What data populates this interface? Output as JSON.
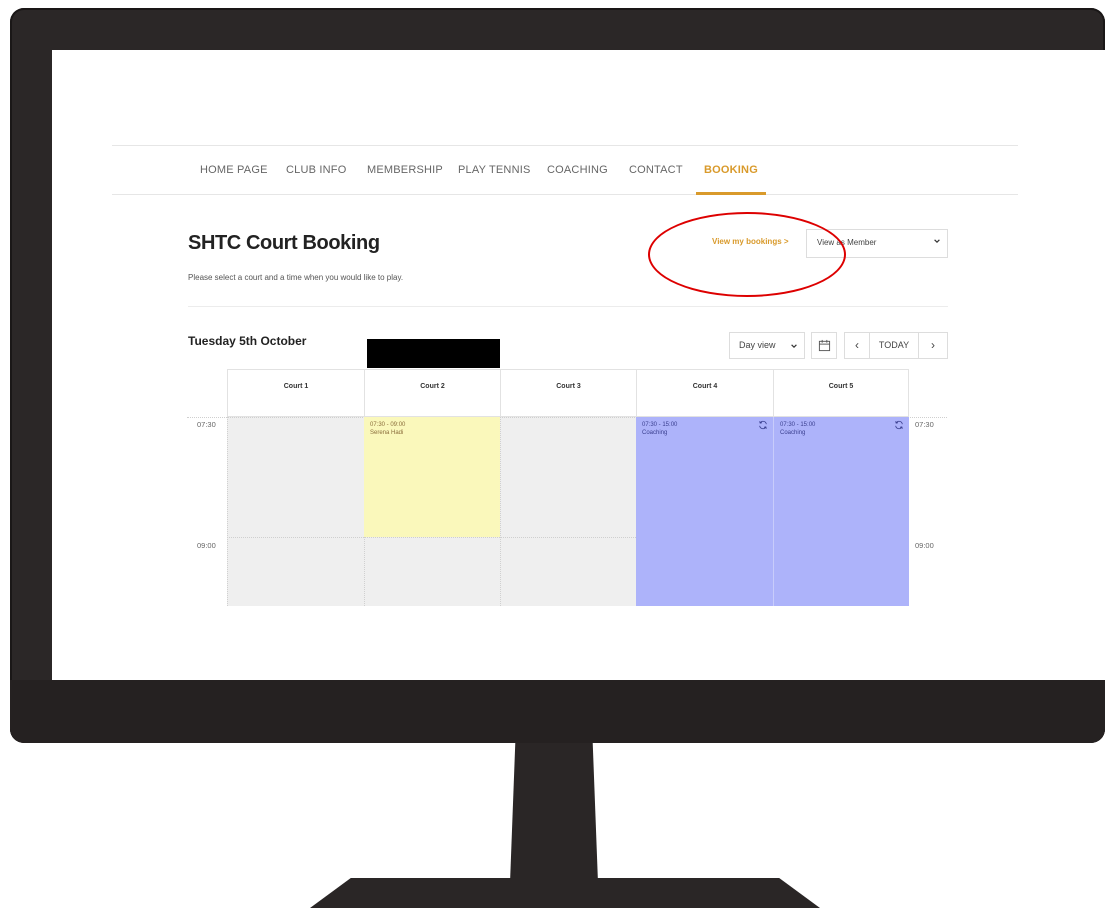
{
  "nav": {
    "items": [
      {
        "label": "HOME PAGE",
        "active": false
      },
      {
        "label": "CLUB INFO",
        "active": false
      },
      {
        "label": "MEMBERSHIP",
        "active": false
      },
      {
        "label": "PLAY TENNIS",
        "active": false
      },
      {
        "label": "COACHING",
        "active": false
      },
      {
        "label": "CONTACT",
        "active": false
      },
      {
        "label": "BOOKING",
        "active": true
      }
    ]
  },
  "page": {
    "title": "SHTC Court Booking",
    "subtitle": "Please select a court and a time when you would like to play.",
    "my_bookings_link": "View my bookings >",
    "view_as": "View as Member"
  },
  "calendar": {
    "date": "Tuesday 5th October",
    "view_mode": "Day view",
    "today_label": "TODAY",
    "prev_label": "‹",
    "next_label": "›",
    "courts": [
      "Court 1",
      "Court 2",
      "Court 3",
      "Court 4",
      "Court 5"
    ],
    "times": [
      "07:30",
      "09:00"
    ],
    "events": [
      {
        "court": "Court 2",
        "time": "07:30 - 09:00",
        "title": "Serena Hadi",
        "color": "#faf8bb",
        "recurring": false
      },
      {
        "court": "Court 4",
        "time": "07:30 - 15:00",
        "title": "Coaching",
        "color": "#adb3fa",
        "recurring": true
      },
      {
        "court": "Court 5",
        "time": "07:30 - 15:00",
        "title": "Coaching",
        "color": "#adb3fa",
        "recurring": true
      }
    ]
  },
  "colors": {
    "accent": "#d99a2b",
    "annotation_circle": "#dd0000",
    "free_slot": "#efefef"
  }
}
